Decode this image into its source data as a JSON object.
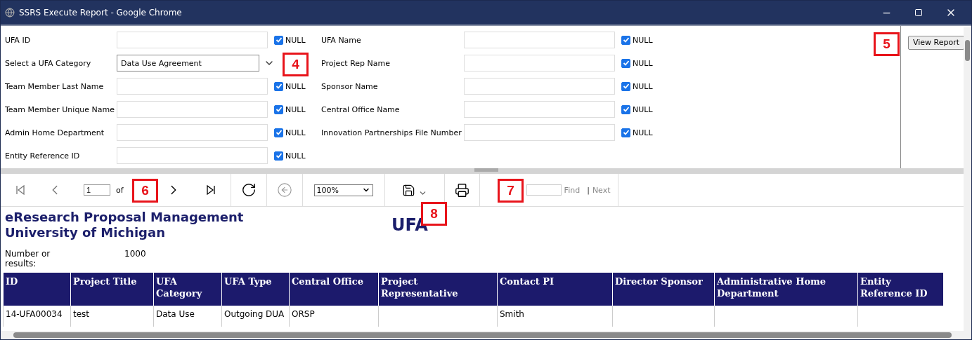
{
  "window": {
    "title": "SSRS Execute Report - Google Chrome"
  },
  "parameters": {
    "left": [
      {
        "label": "UFA ID",
        "kind": "text",
        "null_checked": true,
        "null_label": "NULL"
      },
      {
        "label": "Select a UFA Category",
        "kind": "select",
        "value": "Data Use Agreement"
      },
      {
        "label": "Team Member Last Name",
        "kind": "text",
        "null_checked": true,
        "null_label": "NULL"
      },
      {
        "label": "Team Member Unique Name",
        "kind": "text",
        "null_checked": true,
        "null_label": "NULL"
      },
      {
        "label": "Admin Home Department",
        "kind": "text",
        "null_checked": true,
        "null_label": "NULL"
      },
      {
        "label": "Entity Reference ID",
        "kind": "text",
        "null_checked": true,
        "null_label": "NULL"
      }
    ],
    "right": [
      {
        "label": "UFA Name",
        "kind": "text",
        "null_checked": true,
        "null_label": "NULL"
      },
      {
        "label": "Project Rep Name",
        "kind": "text",
        "null_checked": true,
        "null_label": "NULL"
      },
      {
        "label": "Sponsor Name",
        "kind": "text",
        "null_checked": true,
        "null_label": "NULL"
      },
      {
        "label": "Central Office Name",
        "kind": "text",
        "null_checked": true,
        "null_label": "NULL"
      },
      {
        "label": "Innovation Partnerships File Number",
        "kind": "text",
        "null_checked": true,
        "null_label": "NULL"
      }
    ],
    "view_report": "View Report"
  },
  "toolbar": {
    "page": "1",
    "of": "of",
    "zoom": "100%",
    "find": "Find",
    "separator": "|",
    "next": "Next"
  },
  "report": {
    "heading": [
      "eResearch Proposal Management",
      "University of Michigan"
    ],
    "title": "UFA",
    "count_label": "Number or results:",
    "count_value": "1000",
    "table": {
      "columns": [
        "ID",
        "Project Title",
        "UFA Category",
        "UFA Type",
        "Central Office",
        "Project Representative",
        "Contact PI",
        "Director Sponsor",
        "Administrative Home Department",
        "Entity Reference ID"
      ],
      "rows": [
        [
          "14-UFA00034",
          "test",
          "Data Use",
          "Outgoing DUA",
          "ORSP",
          "",
          "Smith",
          "",
          "",
          ""
        ]
      ]
    }
  },
  "annotations": [
    "4",
    "5",
    "6",
    "7",
    "8"
  ]
}
